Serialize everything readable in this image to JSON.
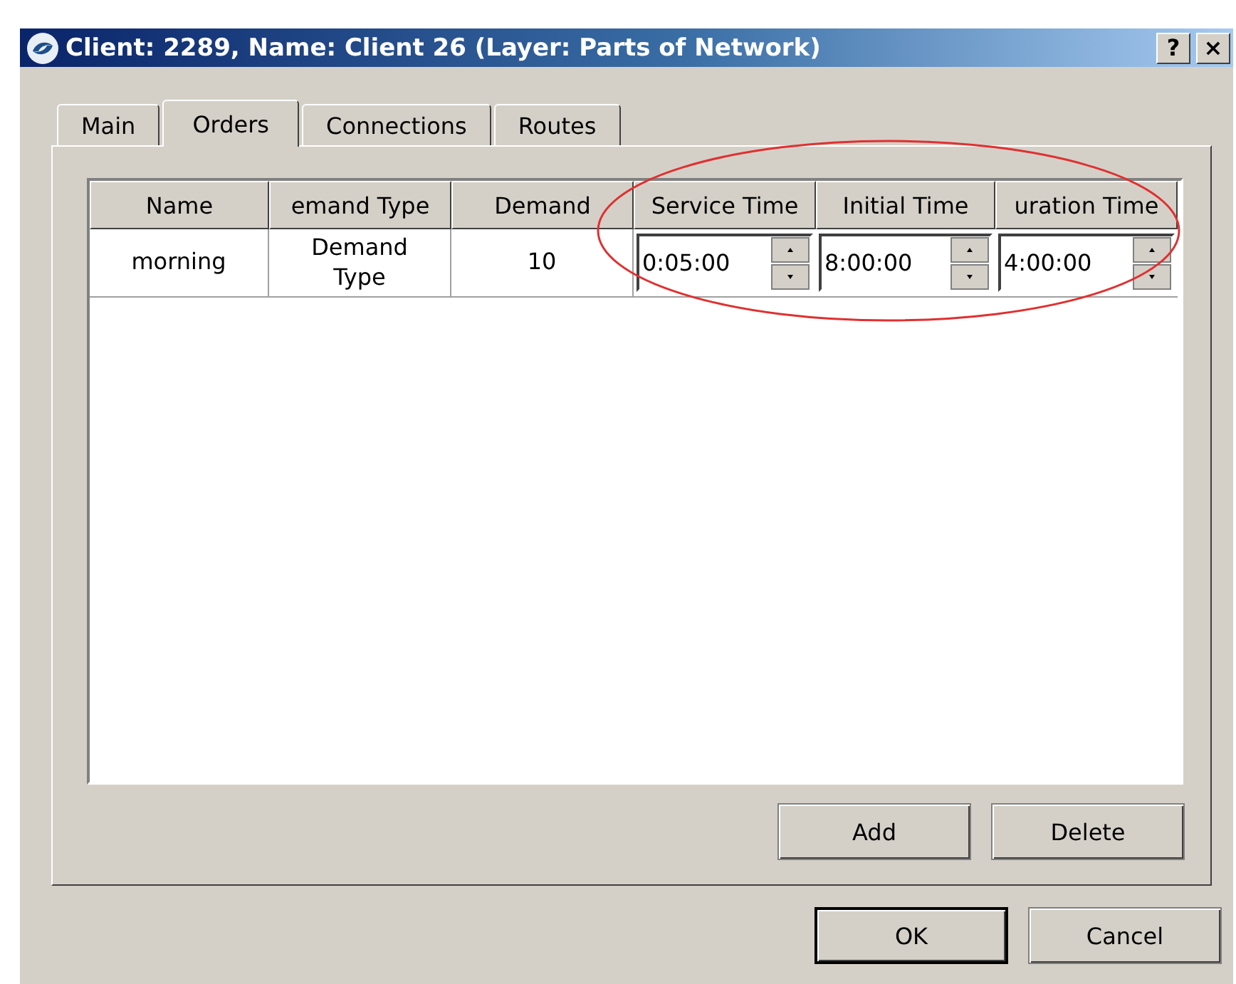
{
  "window": {
    "title": "Client: 2289, Name: Client 26 (Layer: Parts of Network)",
    "title_buttons": [
      "?",
      "×"
    ]
  },
  "tabs": [
    {
      "label": "Main",
      "selected": false
    },
    {
      "label": "Orders",
      "selected": true
    },
    {
      "label": "Connections",
      "selected": false
    },
    {
      "label": "Routes",
      "selected": false
    }
  ],
  "table": {
    "columns": [
      "Name",
      "emand Type",
      "Demand",
      "Service Time",
      "Initial Time",
      "uration Time"
    ],
    "rows": [
      {
        "cells": [
          {
            "kind": "text",
            "value": "morning"
          },
          {
            "kind": "text",
            "value": "Demand Type"
          },
          {
            "kind": "text",
            "value": "10"
          },
          {
            "kind": "spin",
            "value": "0:05:00"
          },
          {
            "kind": "spin",
            "value": "8:00:00"
          },
          {
            "kind": "spin",
            "value": "4:00:00"
          }
        ]
      }
    ]
  },
  "panel_buttons": [
    "Add",
    "Delete"
  ],
  "dialog_buttons": [
    {
      "label": "OK",
      "default": true
    },
    {
      "label": "Cancel",
      "default": false
    }
  ]
}
